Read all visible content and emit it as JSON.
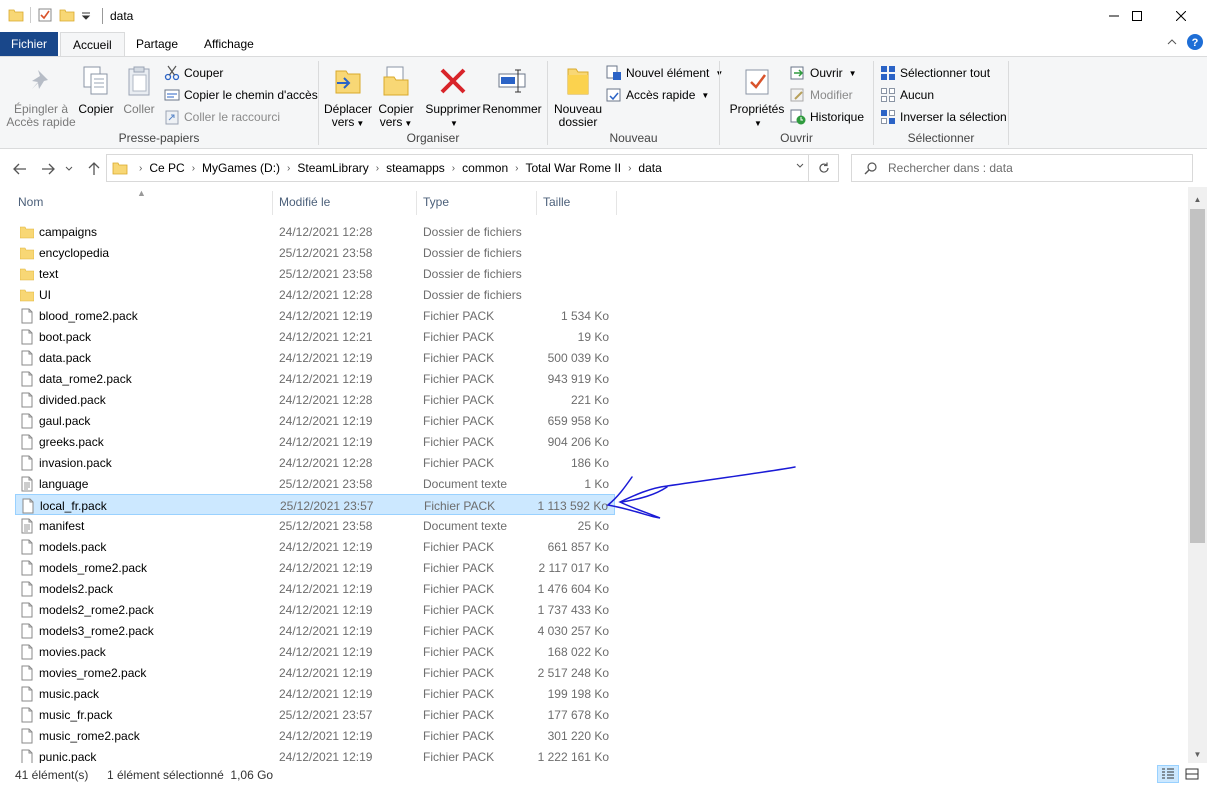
{
  "window": {
    "title": "data",
    "minimize_label": "Minimize",
    "maximize_label": "Maximize",
    "close_label": "Close"
  },
  "tabs": {
    "file": "Fichier",
    "home": "Accueil",
    "share": "Partage",
    "view": "Affichage"
  },
  "ribbon": {
    "clipboard": {
      "label": "Presse-papiers",
      "pin": [
        "Épingler à",
        "Accès rapide"
      ],
      "copy": "Copier",
      "paste": "Coller",
      "cut": "Couper",
      "copy_path": "Copier le chemin d'accès",
      "paste_shortcut": "Coller le raccourci"
    },
    "organize": {
      "label": "Organiser",
      "move_to": [
        "Déplacer",
        "vers"
      ],
      "copy_to": [
        "Copier",
        "vers"
      ],
      "delete": "Supprimer",
      "rename": "Renommer"
    },
    "new": {
      "label": "Nouveau",
      "new_folder": [
        "Nouveau",
        "dossier"
      ],
      "new_item": "Nouvel élément",
      "easy_access": "Accès rapide"
    },
    "open": {
      "label": "Ouvrir",
      "properties": "Propriétés",
      "open": "Ouvrir",
      "edit": "Modifier",
      "history": "Historique"
    },
    "select": {
      "label": "Sélectionner",
      "select_all": "Sélectionner tout",
      "select_none": "Aucun",
      "invert": "Inverser la sélection"
    }
  },
  "address": {
    "crumbs": [
      "Ce PC",
      "MyGames (D:)",
      "SteamLibrary",
      "steamapps",
      "common",
      "Total War Rome II",
      "data"
    ],
    "search_placeholder": "Rechercher dans : data"
  },
  "columns": {
    "name": "Nom",
    "modified": "Modifié le",
    "type": "Type",
    "size": "Taille"
  },
  "files": [
    {
      "name": "campaigns",
      "date": "24/12/2021 12:28",
      "type": "Dossier de fichiers",
      "size": "",
      "kind": "folder"
    },
    {
      "name": "encyclopedia",
      "date": "25/12/2021 23:58",
      "type": "Dossier de fichiers",
      "size": "",
      "kind": "folder"
    },
    {
      "name": "text",
      "date": "25/12/2021 23:58",
      "type": "Dossier de fichiers",
      "size": "",
      "kind": "folder"
    },
    {
      "name": "UI",
      "date": "24/12/2021 12:28",
      "type": "Dossier de fichiers",
      "size": "",
      "kind": "folder"
    },
    {
      "name": "blood_rome2.pack",
      "date": "24/12/2021 12:19",
      "type": "Fichier PACK",
      "size": "1 534 Ko",
      "kind": "file"
    },
    {
      "name": "boot.pack",
      "date": "24/12/2021 12:21",
      "type": "Fichier PACK",
      "size": "19 Ko",
      "kind": "file"
    },
    {
      "name": "data.pack",
      "date": "24/12/2021 12:19",
      "type": "Fichier PACK",
      "size": "500 039 Ko",
      "kind": "file"
    },
    {
      "name": "data_rome2.pack",
      "date": "24/12/2021 12:19",
      "type": "Fichier PACK",
      "size": "943 919 Ko",
      "kind": "file"
    },
    {
      "name": "divided.pack",
      "date": "24/12/2021 12:28",
      "type": "Fichier PACK",
      "size": "221 Ko",
      "kind": "file"
    },
    {
      "name": "gaul.pack",
      "date": "24/12/2021 12:19",
      "type": "Fichier PACK",
      "size": "659 958 Ko",
      "kind": "file"
    },
    {
      "name": "greeks.pack",
      "date": "24/12/2021 12:19",
      "type": "Fichier PACK",
      "size": "904 206 Ko",
      "kind": "file"
    },
    {
      "name": "invasion.pack",
      "date": "24/12/2021 12:28",
      "type": "Fichier PACK",
      "size": "186 Ko",
      "kind": "file"
    },
    {
      "name": "language",
      "date": "25/12/2021 23:58",
      "type": "Document texte",
      "size": "1 Ko",
      "kind": "text"
    },
    {
      "name": "local_fr.pack",
      "date": "25/12/2021 23:57",
      "type": "Fichier PACK",
      "size": "1 113 592 Ko",
      "kind": "file",
      "selected": true
    },
    {
      "name": "manifest",
      "date": "25/12/2021 23:58",
      "type": "Document texte",
      "size": "25 Ko",
      "kind": "text"
    },
    {
      "name": "models.pack",
      "date": "24/12/2021 12:19",
      "type": "Fichier PACK",
      "size": "661 857 Ko",
      "kind": "file"
    },
    {
      "name": "models_rome2.pack",
      "date": "24/12/2021 12:19",
      "type": "Fichier PACK",
      "size": "2 117 017 Ko",
      "kind": "file"
    },
    {
      "name": "models2.pack",
      "date": "24/12/2021 12:19",
      "type": "Fichier PACK",
      "size": "1 476 604 Ko",
      "kind": "file"
    },
    {
      "name": "models2_rome2.pack",
      "date": "24/12/2021 12:19",
      "type": "Fichier PACK",
      "size": "1 737 433 Ko",
      "kind": "file"
    },
    {
      "name": "models3_rome2.pack",
      "date": "24/12/2021 12:19",
      "type": "Fichier PACK",
      "size": "4 030 257 Ko",
      "kind": "file"
    },
    {
      "name": "movies.pack",
      "date": "24/12/2021 12:19",
      "type": "Fichier PACK",
      "size": "168 022 Ko",
      "kind": "file"
    },
    {
      "name": "movies_rome2.pack",
      "date": "24/12/2021 12:19",
      "type": "Fichier PACK",
      "size": "2 517 248 Ko",
      "kind": "file"
    },
    {
      "name": "music.pack",
      "date": "24/12/2021 12:19",
      "type": "Fichier PACK",
      "size": "199 198 Ko",
      "kind": "file"
    },
    {
      "name": "music_fr.pack",
      "date": "25/12/2021 23:57",
      "type": "Fichier PACK",
      "size": "177 678 Ko",
      "kind": "file"
    },
    {
      "name": "music_rome2.pack",
      "date": "24/12/2021 12:19",
      "type": "Fichier PACK",
      "size": "301 220 Ko",
      "kind": "file"
    },
    {
      "name": "punic.pack",
      "date": "24/12/2021 12:19",
      "type": "Fichier PACK",
      "size": "1 222 161 Ko",
      "kind": "file"
    }
  ],
  "status": {
    "count": "41 élément(s)",
    "selection": "1 élément sélectionné  1,06 Go"
  },
  "colors": {
    "file_tab": "#19478a",
    "selection_bg": "#cce8ff",
    "selection_border": "#99d1ff",
    "annotation": "#1a1ad6",
    "folder": "#f8d775"
  },
  "icons": {
    "folder": "folder-icon",
    "file": "file-icon",
    "text": "text-document-icon"
  }
}
